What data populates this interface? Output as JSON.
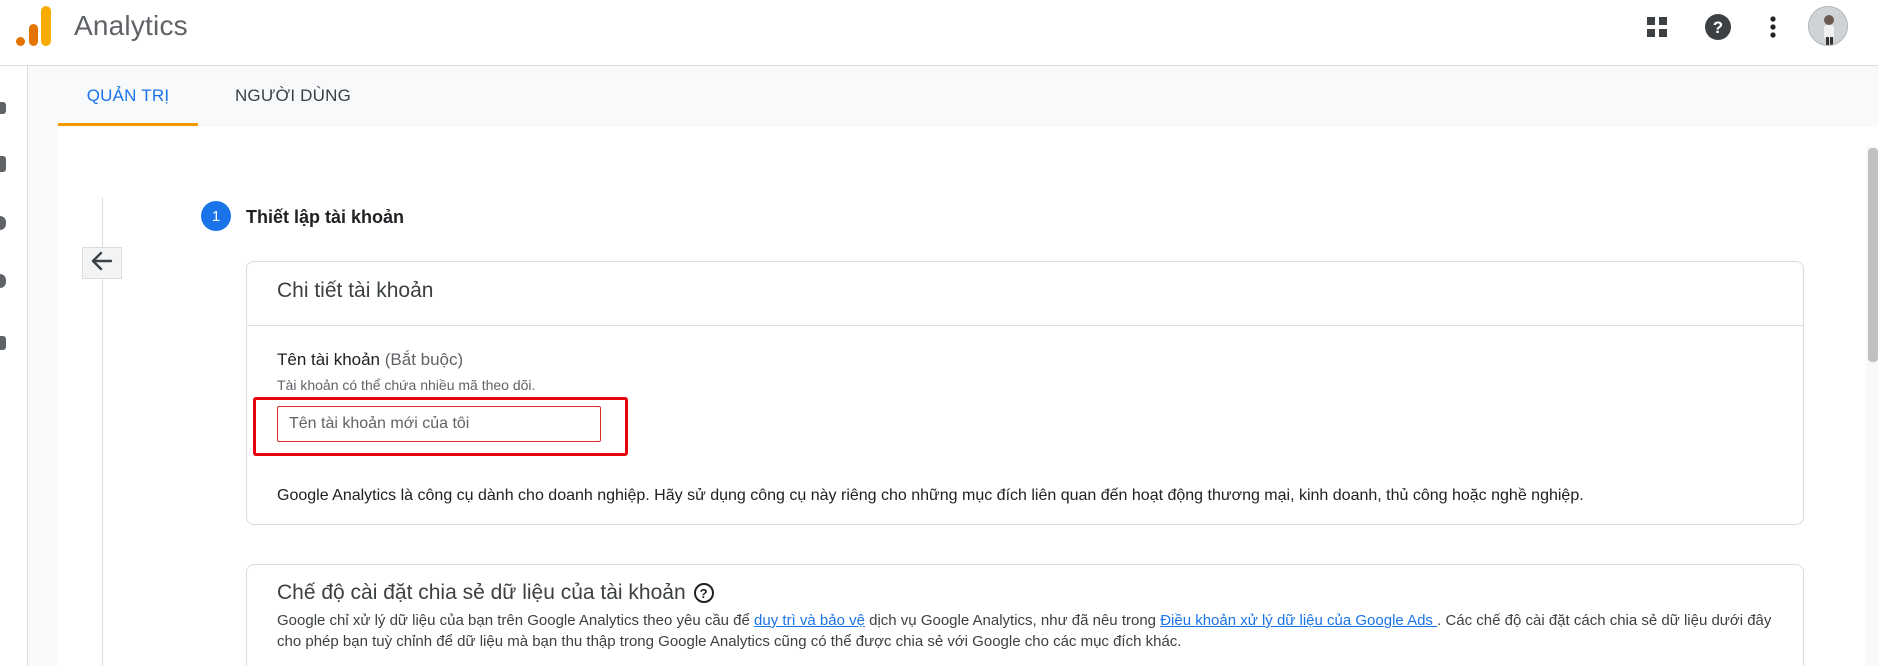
{
  "app": {
    "title": "Analytics"
  },
  "header_icons": [
    "apps-grid-icon",
    "help-icon",
    "more-vert-icon",
    "avatar"
  ],
  "tabs": [
    {
      "label": "QUẢN TRỊ",
      "active": true
    },
    {
      "label": "NGƯỜI DÙNG",
      "active": false
    }
  ],
  "step": {
    "number": "1",
    "title": "Thiết lập tài khoản"
  },
  "account_details": {
    "title": "Chi tiết tài khoản",
    "field_label": "Tên tài khoản",
    "field_required": "(Bắt buộc)",
    "field_hint": "Tài khoản có thể chứa nhiều mã theo dõi.",
    "input_value": "",
    "input_placeholder": "Tên tài khoản mới của tôi",
    "note": "Google Analytics là công cụ dành cho doanh nghiệp. Hãy sử dụng công cụ này riêng cho những mục đích liên quan đến hoạt động thương mại, kinh doanh, thủ công hoặc nghề nghiệp."
  },
  "data_sharing": {
    "title": "Chế độ cài đặt chia sẻ dữ liệu của tài khoản",
    "desc_part1": "Google chỉ xử lý dữ liệu của bạn trên Google Analytics theo yêu cầu để ",
    "link1": "duy trì và bảo vệ",
    "desc_part2": " dịch vụ Google Analytics, như đã nêu trong ",
    "link2": "Điều khoản xử lý dữ liệu của Google Ads ",
    "desc_part3": ". Các chế độ cài đặt cách chia sẻ dữ liệu dưới đây cho phép bạn tuỳ chỉnh để dữ liệu mà bạn thu thập trong Google Analytics cũng có thể được chia sẻ với Google cho các mục đích khác."
  },
  "colors": {
    "accent": "#1a73e8",
    "tab_indicator": "#f29900",
    "highlight_box": "#e8000b",
    "logo_orange": "#e37400",
    "logo_yellow": "#f9ab00"
  }
}
